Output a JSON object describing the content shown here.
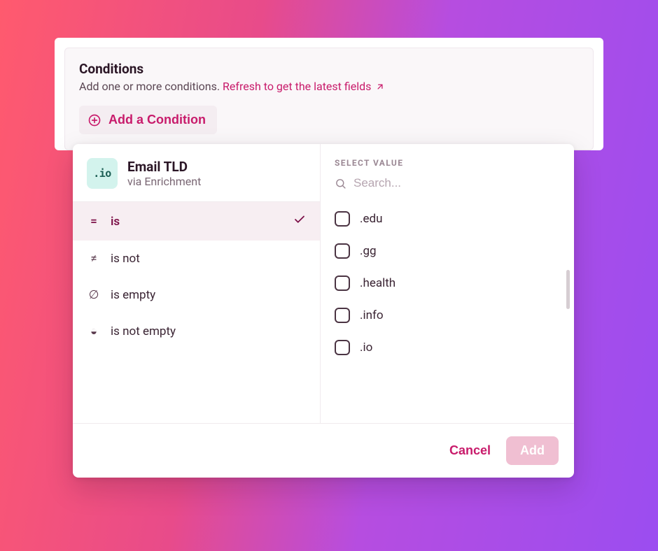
{
  "panel": {
    "title": "Conditions",
    "subtitle": "Add one or more conditions. ",
    "refresh_link": "Refresh to get the latest fields",
    "add_button": "Add a Condition"
  },
  "condition_builder": {
    "field": {
      "badge_text": ".io",
      "name": "Email TLD",
      "source_prefix": "via ",
      "source": "Enrichment"
    },
    "operators": [
      {
        "id": "is",
        "label": "is",
        "icon": "equals",
        "selected": true
      },
      {
        "id": "is_not",
        "label": "is not",
        "icon": "not-equals",
        "selected": false
      },
      {
        "id": "is_empty",
        "label": "is empty",
        "icon": "empty-set",
        "selected": false
      },
      {
        "id": "is_not_empty",
        "label": "is not empty",
        "icon": "half-circle",
        "selected": false
      }
    ],
    "value_section": {
      "heading": "Select Value",
      "search_placeholder": "Search...",
      "options": [
        {
          "label": ".edu",
          "checked": false
        },
        {
          "label": ".gg",
          "checked": false
        },
        {
          "label": ".health",
          "checked": false
        },
        {
          "label": ".info",
          "checked": false
        },
        {
          "label": ".io",
          "checked": false
        }
      ]
    },
    "footer": {
      "cancel": "Cancel",
      "add": "Add"
    }
  }
}
